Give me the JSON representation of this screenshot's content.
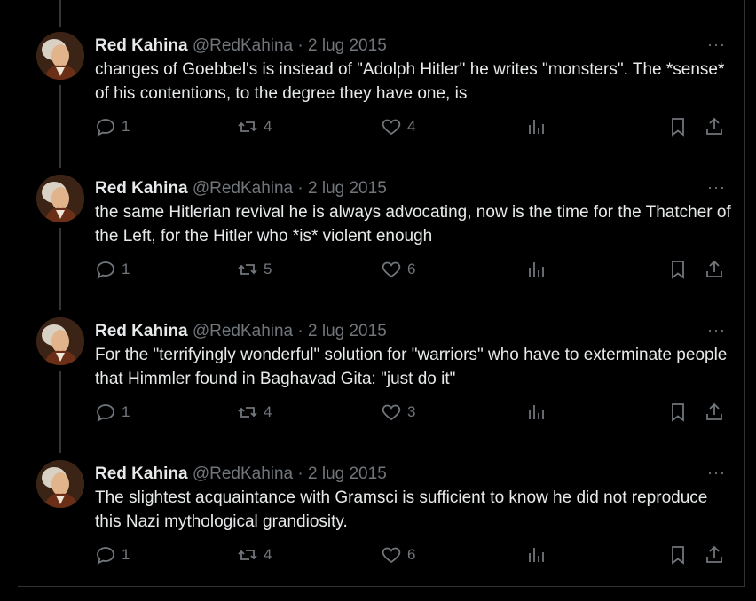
{
  "tweets": [
    {
      "name": "Red Kahina",
      "handle": "@RedKahina",
      "separator": "·",
      "date": "2 lug 2015",
      "more": "···",
      "text": "changes of Goebbel's is instead of \"Adolph Hitler\" he writes \"monsters\". The *sense* of his contentions, to the degree they have one, is",
      "replies": "1",
      "reposts": "4",
      "likes": "4"
    },
    {
      "name": "Red Kahina",
      "handle": "@RedKahina",
      "separator": "·",
      "date": "2 lug 2015",
      "more": "···",
      "text": "the same Hitlerian revival he is always advocating, now is the time for the Thatcher of the Left, for the Hitler who *is* violent enough",
      "replies": "1",
      "reposts": "5",
      "likes": "6"
    },
    {
      "name": "Red Kahina",
      "handle": "@RedKahina",
      "separator": "·",
      "date": "2 lug 2015",
      "more": "···",
      "text": "For the \"terrifyingly wonderful\" solution for \"warriors\" who have to exterminate people that Himmler found in Baghavad Gita: \"just do it\"",
      "replies": "1",
      "reposts": "4",
      "likes": "3"
    },
    {
      "name": "Red Kahina",
      "handle": "@RedKahina",
      "separator": "·",
      "date": "2 lug 2015",
      "more": "···",
      "text": "The slightest acquaintance with Gramsci  is sufficient to know he did not reproduce this Nazi mythological grandiosity.",
      "replies": "1",
      "reposts": "4",
      "likes": "6"
    }
  ],
  "icons": {
    "reply": "reply-icon",
    "repost": "repost-icon",
    "like": "heart-icon",
    "views": "views-icon",
    "bookmark": "bookmark-icon",
    "share": "share-icon",
    "more": "more-icon"
  },
  "colors": {
    "background": "#000000",
    "text": "#e7e9ea",
    "muted": "#71767b",
    "border": "#2f3336"
  }
}
